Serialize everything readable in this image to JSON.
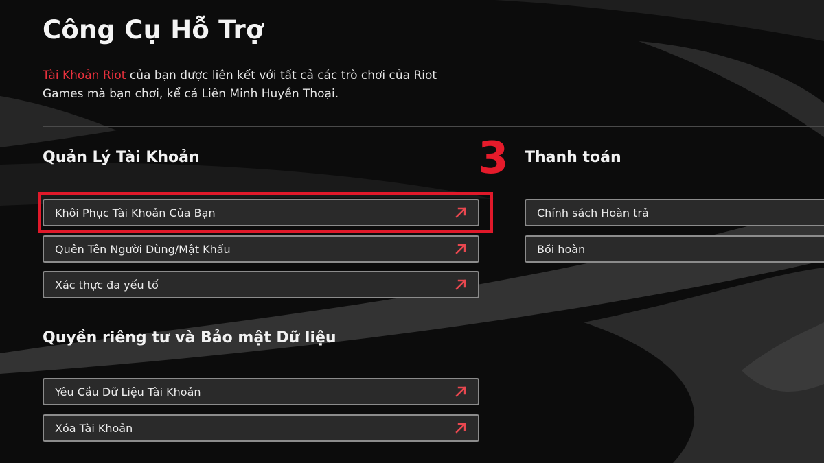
{
  "page": {
    "title": "Công Cụ Hỗ Trợ",
    "intro_accent": "Tài Khoản Riot",
    "intro_rest": " của bạn được liên kết với tất cả các trò chơi của Riot Games mà bạn chơi, kể cả Liên Minh Huyền Thoại.",
    "accent_color": "#e8313d"
  },
  "step_marker": "3",
  "sections": {
    "account": {
      "heading": "Quản Lý Tài Khoản",
      "links": [
        "Khôi Phục Tài Khoản Của Bạn",
        "Quên Tên Người Dùng/Mật Khẩu",
        "Xác thực đa yếu tố"
      ]
    },
    "payment": {
      "heading": "Thanh toán",
      "links": [
        "Chính sách Hoàn trả",
        "Bồi hoàn"
      ]
    },
    "privacy": {
      "heading": "Quyền riêng tư và Bảo mật Dữ liệu",
      "links": [
        "Yêu Cầu Dữ Liệu Tài Khoản",
        "Xóa Tài Khoản"
      ]
    }
  },
  "icons": {
    "link_arrow": "arrow-up-right-icon"
  }
}
